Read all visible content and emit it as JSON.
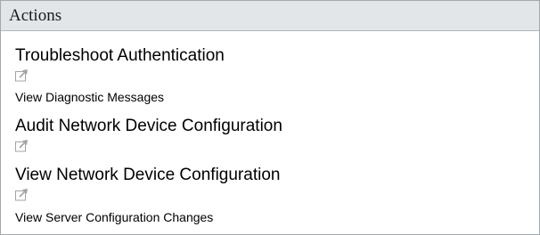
{
  "header": {
    "title": "Actions"
  },
  "actions": [
    {
      "label": "Troubleshoot Authentication",
      "size": "large",
      "icon": "external-link-icon"
    },
    {
      "label": "View Diagnostic Messages",
      "size": "small"
    },
    {
      "label": "Audit Network Device Configuration",
      "size": "large",
      "icon": "external-link-icon"
    },
    {
      "label": "View Network Device Configuration",
      "size": "large",
      "icon": "external-link-icon"
    },
    {
      "label": "View Server Configuration Changes",
      "size": "small"
    }
  ],
  "colors": {
    "header_bg": "#e2e6e8",
    "border": "#a5a8aa",
    "icon": "#a0a4a8"
  }
}
